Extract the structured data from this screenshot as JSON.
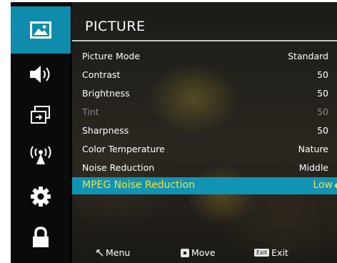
{
  "sidebar": {
    "items": [
      {
        "icon": "picture-icon",
        "active": true
      },
      {
        "icon": "speaker-icon",
        "active": false
      },
      {
        "icon": "input-source-icon",
        "active": false
      },
      {
        "icon": "wireless-signal-icon",
        "active": false
      },
      {
        "icon": "gear-icon",
        "active": false
      },
      {
        "icon": "lock-icon",
        "active": false
      }
    ],
    "accent_color": "#0f8cac"
  },
  "menu": {
    "title": "PICTURE",
    "items": [
      {
        "label": "Picture Mode",
        "value": "Standard"
      },
      {
        "label": "Contrast",
        "value": "50"
      },
      {
        "label": "Brightness",
        "value": "50"
      },
      {
        "label": "Tint",
        "value": "50",
        "disabled": true
      },
      {
        "label": "Sharpness",
        "value": "50"
      },
      {
        "label": "Color Temperature",
        "value": "Nature"
      },
      {
        "label": "Noise Reduction",
        "value": "Middle"
      },
      {
        "label": "MPEG Noise Reduction",
        "value": "Low",
        "selected": true
      }
    ],
    "selected_color": "#1193b4",
    "selected_text_color": "#ffdd33"
  },
  "footer": {
    "menu_label": "Menu",
    "move_label": "Move",
    "exit_key": "Exit",
    "exit_label": "Exit"
  }
}
